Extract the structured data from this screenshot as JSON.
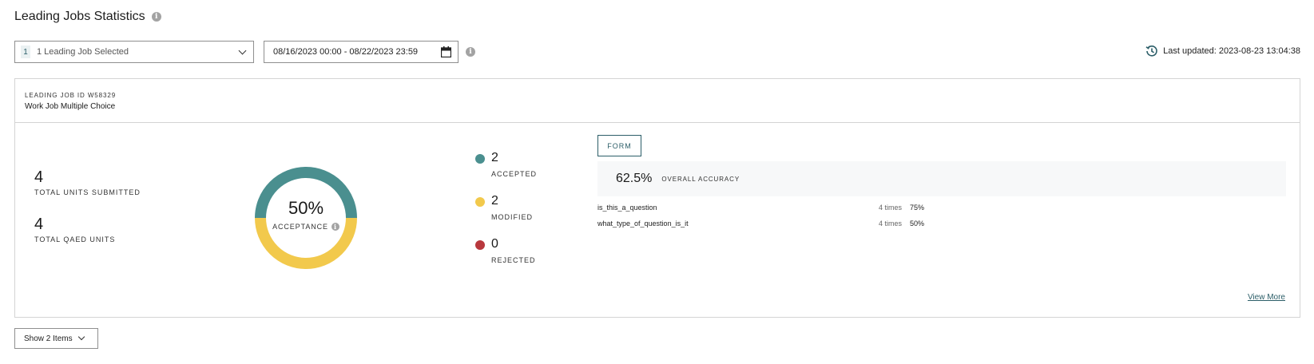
{
  "header": {
    "title": "Leading Jobs Statistics"
  },
  "toolbar": {
    "job_count": "1",
    "job_select_label": "1 Leading Job Selected",
    "date_range": "08/16/2023 00:00 - 08/22/2023 23:59",
    "last_updated": "Last updated: 2023-08-23 13:04:38"
  },
  "card": {
    "job_id_label": "LEADING JOB ID W58329",
    "job_name": "Work Job Multiple Choice",
    "stats": [
      {
        "value": "4",
        "label": "TOTAL UNITS SUBMITTED"
      },
      {
        "value": "4",
        "label": "TOTAL QAED UNITS"
      }
    ],
    "acceptance": {
      "percent": "50%",
      "label": "ACCEPTANCE",
      "segments": [
        {
          "name": "accepted",
          "value": 2,
          "color": "#4a8f8f"
        },
        {
          "name": "modified",
          "value": 2,
          "color": "#f2c94c"
        }
      ]
    },
    "legend": [
      {
        "value": "2",
        "label": "ACCEPTED",
        "color": "#4a8f8f"
      },
      {
        "value": "2",
        "label": "MODIFIED",
        "color": "#f2c94c"
      },
      {
        "value": "0",
        "label": "REJECTED",
        "color": "#b8383d"
      }
    ],
    "form_tab": "FORM",
    "overall_accuracy": {
      "value": "62.5%",
      "label": "OVERALL ACCURACY"
    },
    "questions": [
      {
        "name": "is_this_a_question",
        "times": "4 times",
        "percent": "75%"
      },
      {
        "name": "what_type_of_question_is_it",
        "times": "4 times",
        "percent": "50%"
      }
    ],
    "view_more": "View More"
  },
  "footer": {
    "show_items": "Show 2 Items"
  },
  "colors": {
    "accent": "#2c5e68",
    "accepted": "#4a8f8f",
    "modified": "#f2c94c",
    "rejected": "#b8383d"
  }
}
